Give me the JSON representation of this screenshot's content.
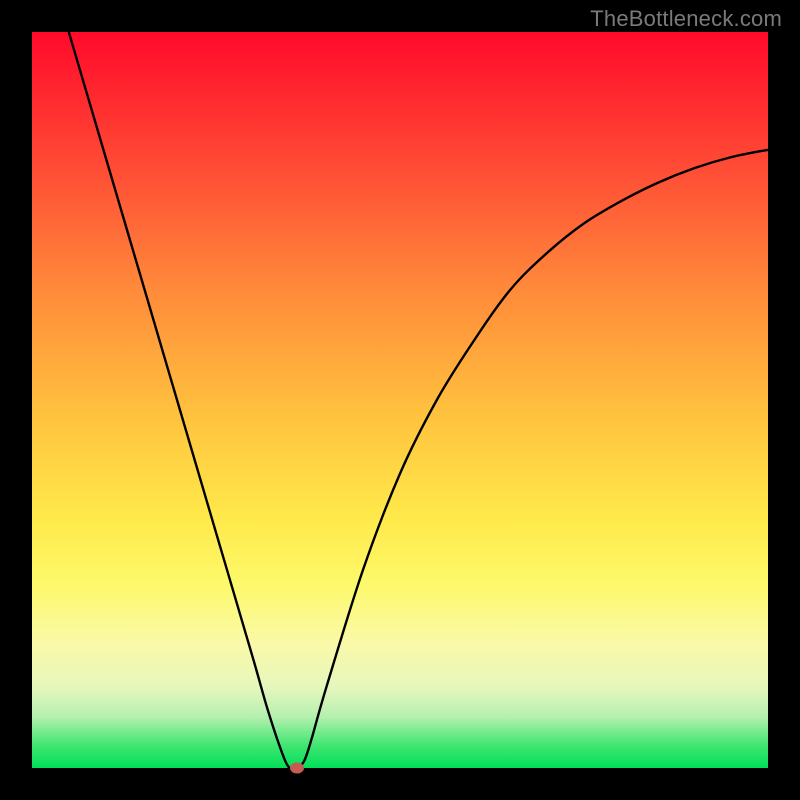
{
  "watermark": "TheBottleneck.com",
  "colors": {
    "frame": "#000000",
    "curve": "#000000",
    "marker": "#c75a52"
  },
  "chart_data": {
    "type": "line",
    "title": "",
    "xlabel": "",
    "ylabel": "",
    "xlim": [
      0,
      100
    ],
    "ylim": [
      0,
      100
    ],
    "grid": false,
    "legend": false,
    "series": [
      {
        "name": "curve",
        "x": [
          5,
          10,
          15,
          20,
          25,
          30,
          32,
          34,
          35,
          36,
          37,
          38,
          40,
          45,
          50,
          55,
          60,
          65,
          70,
          75,
          80,
          85,
          90,
          95,
          100
        ],
        "y": [
          100,
          83,
          66,
          49,
          32,
          15,
          8,
          2,
          0,
          0,
          1,
          4,
          11,
          27,
          40,
          50,
          58,
          65,
          70,
          74,
          77,
          79.5,
          81.5,
          83,
          84
        ]
      }
    ],
    "marker": {
      "x": 36,
      "y": 0
    },
    "annotations": []
  }
}
